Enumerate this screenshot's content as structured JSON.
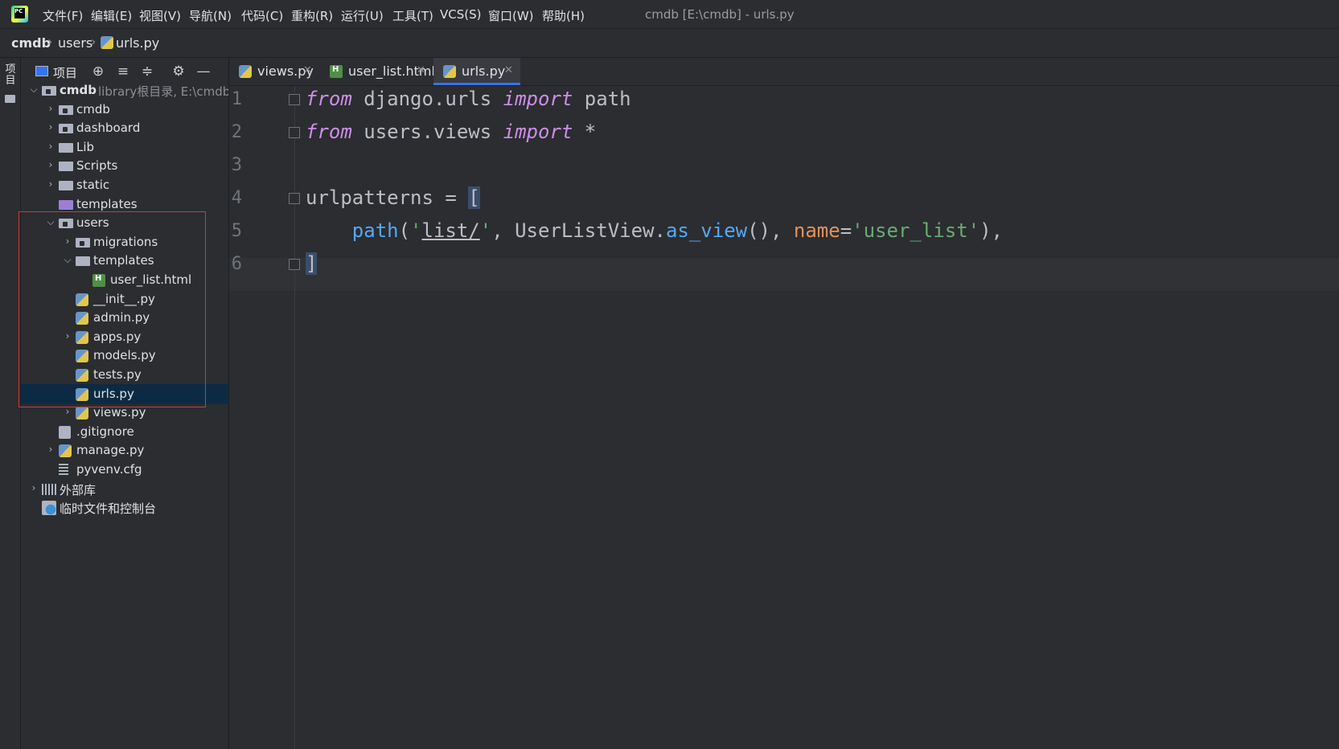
{
  "menu": {
    "items": [
      "文件(F)",
      "编辑(E)",
      "视图(V)",
      "导航(N)",
      "代码(C)",
      "重构(R)",
      "运行(U)",
      "工具(T)",
      "VCS(S)",
      "窗口(W)",
      "帮助(H)"
    ],
    "window_title": "cmdb [E:\\cmdb] - urls.py"
  },
  "breadcrumb": [
    "cmdb",
    "users",
    "urls.py"
  ],
  "left_stripe": {
    "project_label": "项目"
  },
  "project_panel": {
    "title": "项目",
    "icons": [
      "locate-icon",
      "expand-all-icon",
      "collapse-all-icon",
      "gear-icon",
      "minimize-icon"
    ],
    "tree": [
      {
        "label": "cmdb",
        "hint": "library根目录,  E:\\cmdb",
        "depth": 0,
        "type": "folder-module",
        "expanded": true,
        "bold": true
      },
      {
        "label": "cmdb",
        "depth": 1,
        "type": "folder-module",
        "chevron": "collapsed"
      },
      {
        "label": "dashboard",
        "depth": 1,
        "type": "folder-module",
        "chevron": "collapsed"
      },
      {
        "label": "Lib",
        "depth": 1,
        "type": "folder",
        "chevron": "collapsed"
      },
      {
        "label": "Scripts",
        "depth": 1,
        "type": "folder",
        "chevron": "collapsed"
      },
      {
        "label": "static",
        "depth": 1,
        "type": "folder",
        "chevron": "collapsed"
      },
      {
        "label": "templates",
        "depth": 1,
        "type": "folder-templates",
        "chevron": "none"
      },
      {
        "label": "users",
        "depth": 1,
        "type": "folder-module",
        "chevron": "expanded"
      },
      {
        "label": "migrations",
        "depth": 2,
        "type": "folder-module",
        "chevron": "collapsed"
      },
      {
        "label": "templates",
        "depth": 2,
        "type": "folder",
        "chevron": "expanded"
      },
      {
        "label": "user_list.html",
        "depth": 3,
        "type": "html",
        "chevron": "none"
      },
      {
        "label": "__init__.py",
        "depth": 2,
        "type": "py",
        "chevron": "none"
      },
      {
        "label": "admin.py",
        "depth": 2,
        "type": "py",
        "chevron": "none"
      },
      {
        "label": "apps.py",
        "depth": 2,
        "type": "py",
        "chevron": "collapsed"
      },
      {
        "label": "models.py",
        "depth": 2,
        "type": "py",
        "chevron": "none"
      },
      {
        "label": "tests.py",
        "depth": 2,
        "type": "py",
        "chevron": "none"
      },
      {
        "label": "urls.py",
        "depth": 2,
        "type": "py",
        "chevron": "none",
        "selected": true
      },
      {
        "label": "views.py",
        "depth": 2,
        "type": "py",
        "chevron": "collapsed"
      },
      {
        "label": ".gitignore",
        "depth": 1,
        "type": "git",
        "chevron": "none"
      },
      {
        "label": "manage.py",
        "depth": 1,
        "type": "py",
        "chevron": "collapsed"
      },
      {
        "label": "pyvenv.cfg",
        "depth": 1,
        "type": "text",
        "chevron": "none"
      },
      {
        "label": "外部库",
        "depth": 0,
        "type": "lib",
        "chevron": "collapsed"
      },
      {
        "label": "临时文件和控制台",
        "depth": 0,
        "type": "scratch",
        "chevron": "none"
      }
    ]
  },
  "tabs": [
    {
      "label": "views.py",
      "icon": "python-file-icon",
      "active": false
    },
    {
      "label": "user_list.html",
      "icon": "html-file-icon",
      "active": false
    },
    {
      "label": "urls.py",
      "icon": "python-file-icon",
      "active": true
    }
  ],
  "editor": {
    "line_numbers": [
      "1",
      "2",
      "3",
      "4",
      "5",
      "6"
    ],
    "lines": [
      [
        {
          "t": "from",
          "c": "kw"
        },
        {
          "t": " django.urls "
        },
        {
          "t": "import",
          "c": "kw"
        },
        {
          "t": " path"
        }
      ],
      [
        {
          "t": "from",
          "c": "kw"
        },
        {
          "t": " users.views "
        },
        {
          "t": "import",
          "c": "kw"
        },
        {
          "t": " *"
        }
      ],
      [],
      [
        {
          "t": "urlpatterns = "
        },
        {
          "t": "[",
          "c": "bracket-hl"
        }
      ],
      [
        {
          "t": "    "
        },
        {
          "t": "path",
          "c": "fn"
        },
        {
          "t": "("
        },
        {
          "t": "'",
          "c": "str"
        },
        {
          "t": "list/",
          "c": "str url"
        },
        {
          "t": "'",
          "c": "str"
        },
        {
          "t": ", UserListView."
        },
        {
          "t": "as_view",
          "c": "fn"
        },
        {
          "t": "(), "
        },
        {
          "t": "name",
          "c": "param"
        },
        {
          "t": "="
        },
        {
          "t": "'user_list'",
          "c": "str"
        },
        {
          "t": "),"
        }
      ],
      [
        {
          "t": "]",
          "c": "bracket-hl"
        }
      ]
    ]
  },
  "colors": {
    "background": "#2b2d30",
    "keyword": "#cf8ee8",
    "function": "#56a8f5",
    "string": "#6aab73",
    "parameter": "#e0925d",
    "selection": "#0d2a44",
    "highlight_box": "#d0383a",
    "accent": "#3574f0"
  }
}
